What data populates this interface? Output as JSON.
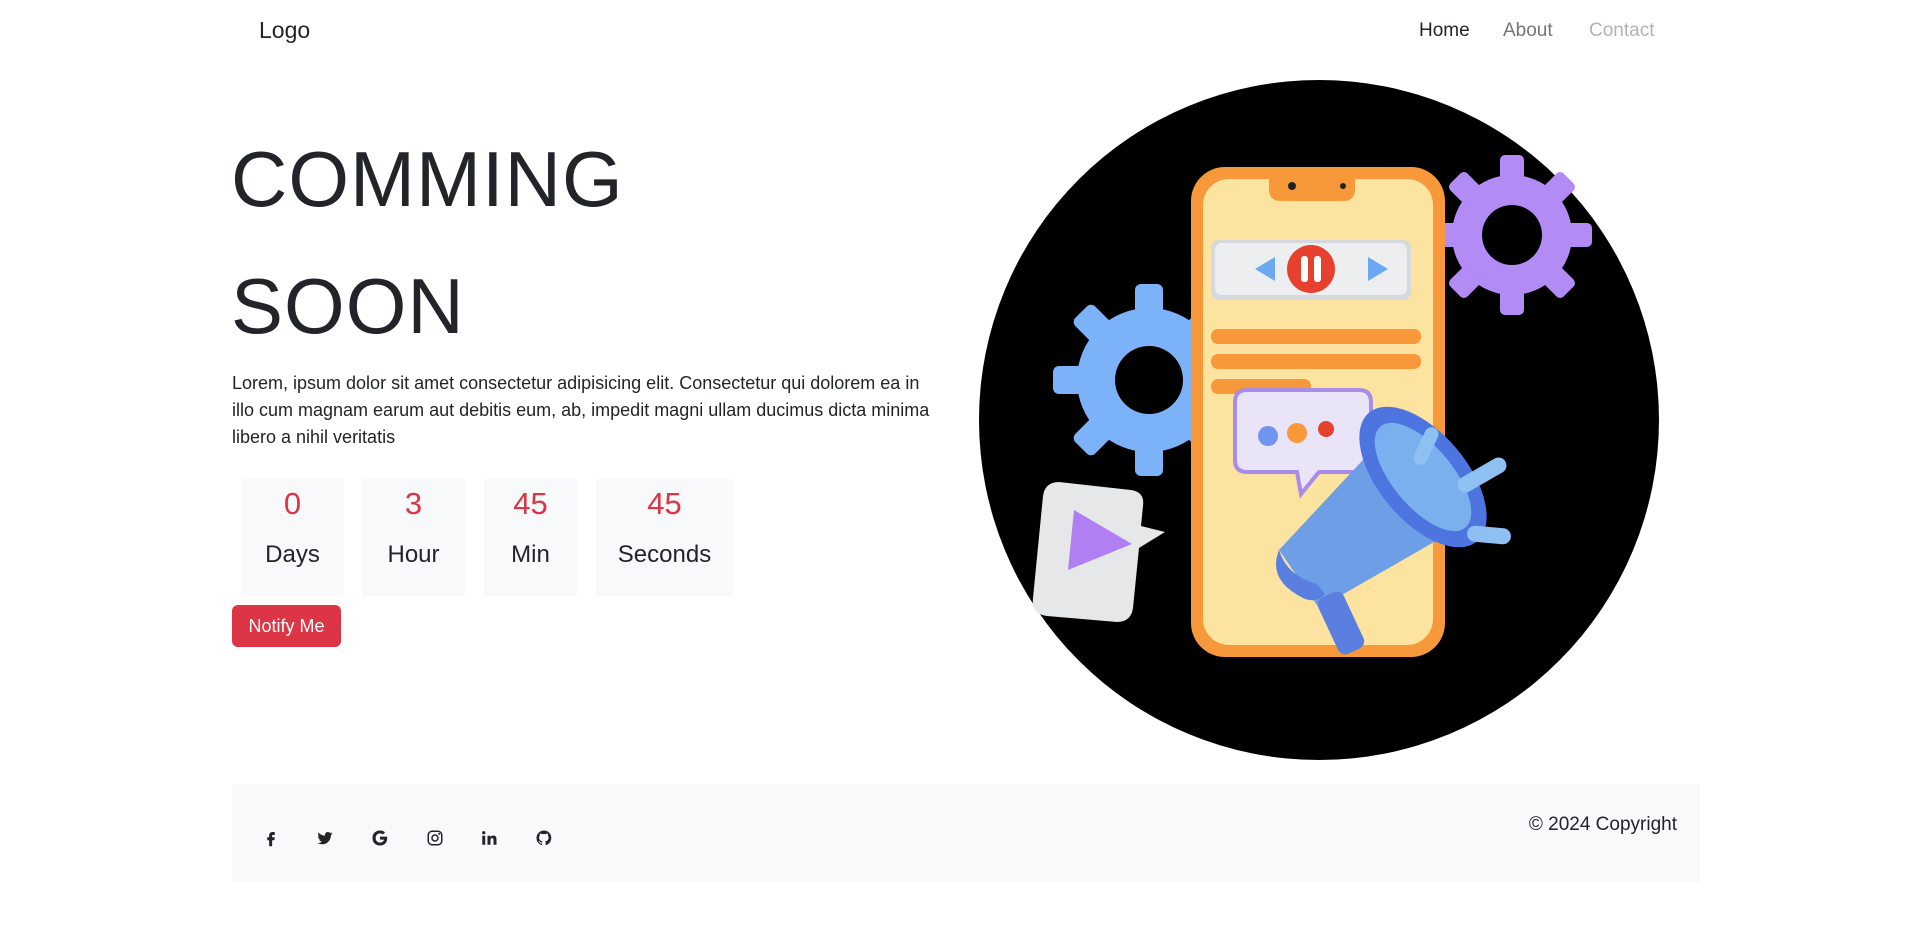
{
  "nav": {
    "brand": "Logo",
    "links": [
      {
        "label": "Home",
        "state": "active"
      },
      {
        "label": "About",
        "state": "normal"
      },
      {
        "label": "Contact",
        "state": "disabled"
      }
    ]
  },
  "hero": {
    "title_line1": "COMMING",
    "title_line2": "SOON",
    "description": "Lorem, ipsum dolor sit amet consectetur adipisicing elit. Consectetur qui dolorem ea in illo cum magnam earum aut debitis eum, ab, impedit magni ullam ducimus dicta minima libero a nihil veritatis",
    "countdown": [
      {
        "value": "0",
        "label": "Days"
      },
      {
        "value": "3",
        "label": "Hour"
      },
      {
        "value": "45",
        "label": "Min"
      },
      {
        "value": "45",
        "label": "Seconds"
      }
    ],
    "notify_label": "Notify Me",
    "illustration": "phone-megaphone-illustration"
  },
  "footer": {
    "social_icons": [
      "facebook-icon",
      "twitter-icon",
      "google-icon",
      "instagram-icon",
      "linkedin-icon",
      "github-icon"
    ],
    "copyright": "© 2024 Copyright"
  },
  "colors": {
    "accent": "#dc3545",
    "text": "#212529",
    "light_bg": "#f8f9fa",
    "illustration_bg": "#000000"
  }
}
